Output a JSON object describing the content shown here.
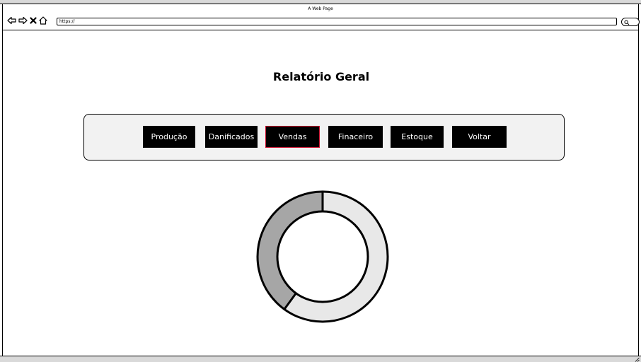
{
  "window": {
    "title": "A Web Page",
    "url": "https://"
  },
  "page": {
    "title": "Relatório Geral"
  },
  "menu": {
    "buttons": [
      {
        "label": "Produção",
        "active": false
      },
      {
        "label": "Danificados",
        "active": false
      },
      {
        "label": "Vendas",
        "active": true
      },
      {
        "label": "Finaceiro",
        "active": false
      },
      {
        "label": "Estoque",
        "active": false
      },
      {
        "label": "Voltar",
        "active": false
      }
    ]
  },
  "chart_data": {
    "type": "pie",
    "style": "donut",
    "values": [
      60,
      40
    ],
    "colors": [
      "#e8e8e8",
      "#a6a6a6"
    ],
    "start_angle_deg": 0,
    "direction": "clockwise"
  },
  "colors": {
    "button_bg": "#000000",
    "button_text": "#ffffff",
    "active_border": "#c8102e",
    "panel_bg": "#f2f2f2"
  },
  "icons": [
    "back-arrow-icon",
    "forward-arrow-icon",
    "close-icon",
    "home-icon",
    "search-icon",
    "resize-grip-icon"
  ]
}
